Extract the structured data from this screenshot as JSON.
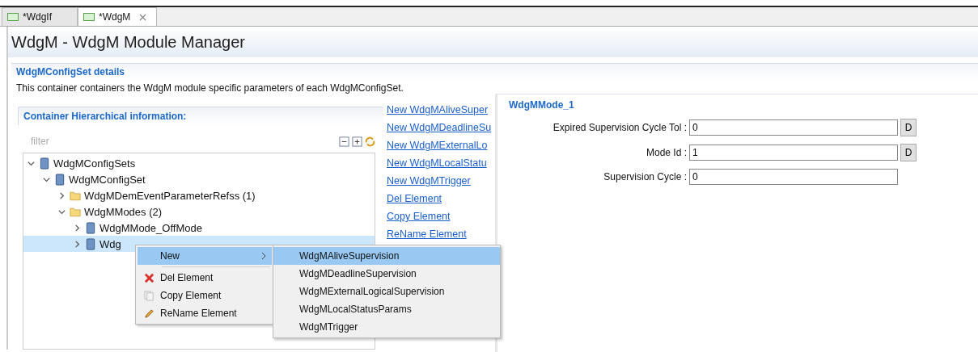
{
  "tabs": [
    {
      "label": "*WdgIf",
      "selected": false,
      "closable": false
    },
    {
      "label": "*WdgM",
      "selected": true,
      "closable": true
    }
  ],
  "page_title": "WdgM - WdgM Module Manager",
  "section": {
    "title": "WdgMConfigSet details",
    "description": "This container containers the WdgM module specific parameters of each WdgMConfigSet."
  },
  "hierarchy": {
    "title": "Container Hierarchical information:",
    "filter_placeholder": "filter",
    "tree": [
      {
        "label": "WdgMConfigSets",
        "kind": "container",
        "expanded": true,
        "selected": false,
        "children": [
          {
            "label": "WdgMConfigSet",
            "kind": "container",
            "expanded": true,
            "selected": false,
            "children": [
              {
                "label": "WdgMDemEventParameterRefss (1)",
                "kind": "folder",
                "expanded": false,
                "selected": false
              },
              {
                "label": "WdgMModes (2)",
                "kind": "folder",
                "expanded": true,
                "selected": false,
                "children": [
                  {
                    "label": "WdgMMode_OffMode",
                    "kind": "container",
                    "expanded": false,
                    "selected": false
                  },
                  {
                    "label": "Wdg",
                    "kind": "container",
                    "expanded": false,
                    "selected": true
                  }
                ]
              }
            ]
          }
        ]
      }
    ]
  },
  "actions": [
    "New WdgMAliveSuper",
    "New WdgMDeadlineSu",
    "New WdgMExternalLo",
    "New WdgMLocalStatu",
    "New WdgMTrigger",
    "Del Element",
    "Copy Element",
    "ReName Element"
  ],
  "context_menu": {
    "items": [
      {
        "label": "New",
        "kind": "submenu",
        "selected": true
      },
      {
        "label": "Del Element",
        "kind": "delete",
        "selected": false
      },
      {
        "label": "Copy Element",
        "kind": "copy",
        "selected": false
      },
      {
        "label": "ReName Element",
        "kind": "rename",
        "selected": false
      }
    ],
    "submenu": [
      {
        "label": "WdgMAliveSupervision",
        "selected": true
      },
      {
        "label": "WdgMDeadlineSupervision",
        "selected": false
      },
      {
        "label": "WdgMExternalLogicalSupervision",
        "selected": false
      },
      {
        "label": "WdgMLocalStatusParams",
        "selected": false
      },
      {
        "label": "WdgMTrigger",
        "selected": false
      }
    ]
  },
  "detail": {
    "title": "WdgMMode_1",
    "fields": [
      {
        "label": "Expired Supervision Cycle Tol :",
        "value": "0",
        "default_button": "D"
      },
      {
        "label": "Mode Id :",
        "value": "1",
        "default_button": "D"
      },
      {
        "label": "Supervision Cycle :",
        "value": "0"
      }
    ]
  }
}
